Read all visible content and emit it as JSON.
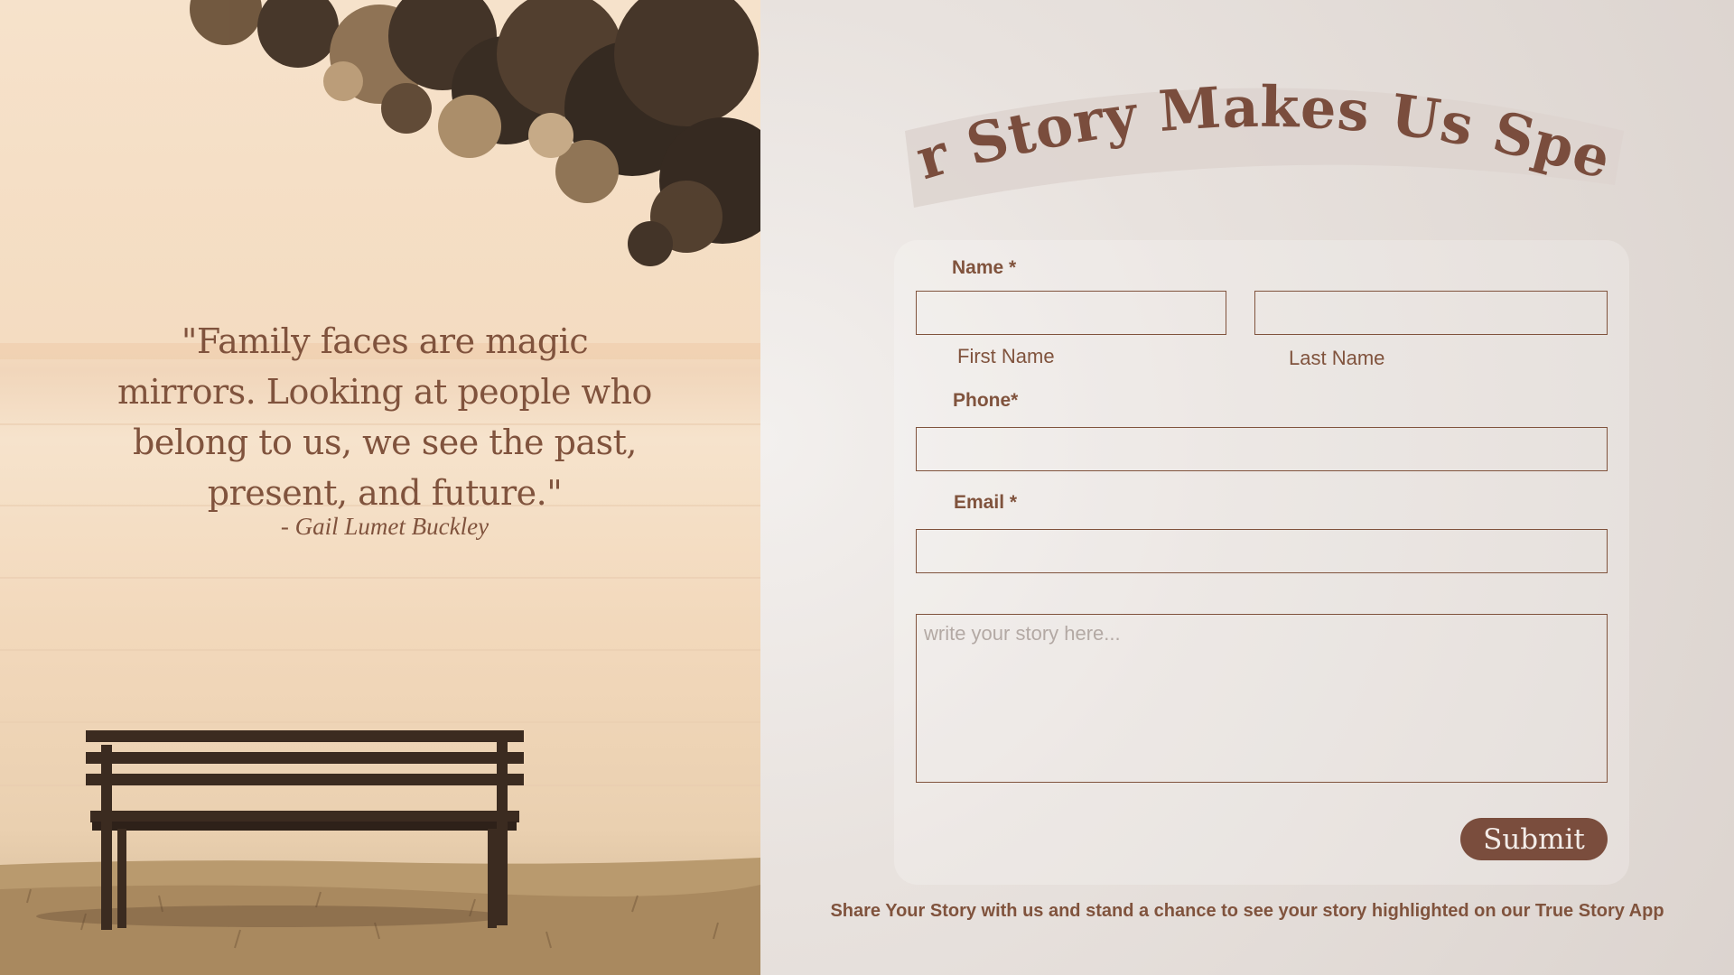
{
  "quote": {
    "text": "\"Family faces are magic mirrors. Looking at people who belong to us, we see the past, present, and future.\"",
    "author": "- Gail Lumet Buckley"
  },
  "form": {
    "title": "Your Story Makes Us Special",
    "name_label": "Name *",
    "first_name_label": "First Name",
    "last_name_label": "Last Name",
    "phone_label": "Phone*",
    "email_label": "Email *",
    "story_placeholder": "write your story here...",
    "first_name_value": "",
    "last_name_value": "",
    "phone_value": "",
    "email_value": "",
    "submit_label": "Submit"
  },
  "footnote": "Share Your Story with us and stand a chance to see your story highlighted on our True Story App",
  "colors": {
    "accent": "#80533d",
    "button": "#7a4d3d",
    "panel_bg": "#e3dbd6",
    "photo_tone": "#f4dcc1"
  }
}
